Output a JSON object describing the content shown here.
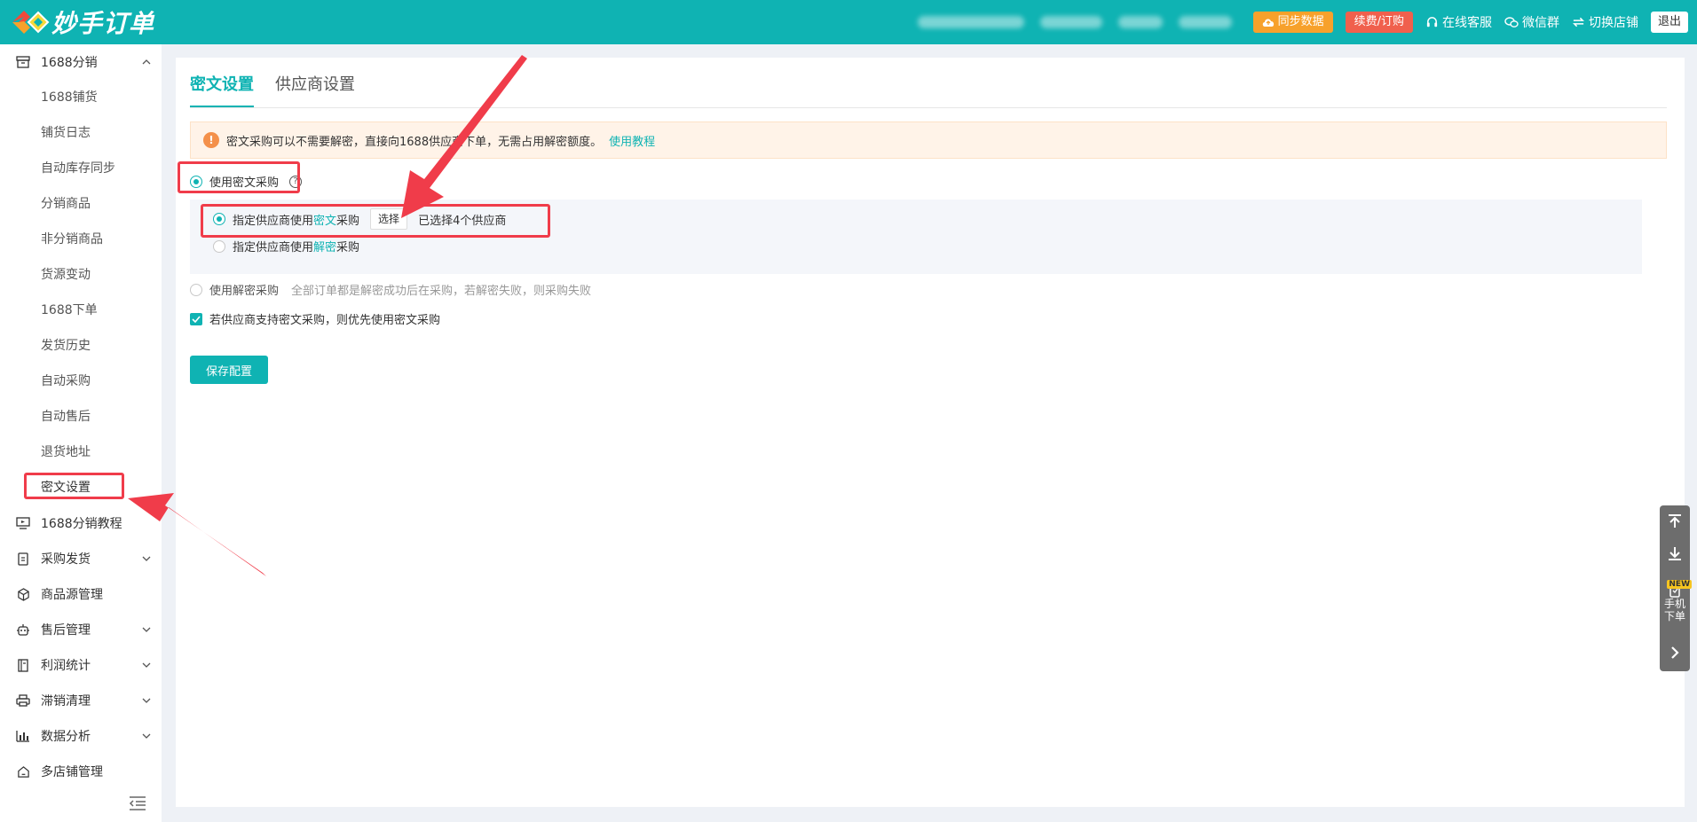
{
  "header": {
    "app_name": "妙手订单",
    "sync_label": "同步数据",
    "renew_label": "续费/订购",
    "support_label": "在线客服",
    "wechat_label": "微信群",
    "switch_shop_label": "切换店铺",
    "logout_label": "退出",
    "colors": {
      "brand": "#0fb3b3",
      "sync": "#f7a12b",
      "renew": "#f0604d"
    }
  },
  "sidebar": {
    "group_1688": "1688分销",
    "sub_items": [
      "1688铺货",
      "铺货日志",
      "自动库存同步",
      "分销商品",
      "非分销商品",
      "货源变动",
      "1688下单",
      "发货历史",
      "自动采购",
      "自动售后",
      "退货地址",
      "密文设置"
    ],
    "groups": [
      {
        "label": "1688分销教程",
        "icon": "monitor-icon"
      },
      {
        "label": "采购发货",
        "icon": "document-icon"
      },
      {
        "label": "商品源管理",
        "icon": "cube-icon"
      },
      {
        "label": "售后管理",
        "icon": "robot-icon"
      },
      {
        "label": "利润统计",
        "icon": "ledger-icon"
      },
      {
        "label": "滞销清理",
        "icon": "printer-icon"
      },
      {
        "label": "数据分析",
        "icon": "bar-chart-icon"
      },
      {
        "label": "多店铺管理",
        "icon": "home-icon"
      }
    ]
  },
  "main": {
    "tabs": [
      "密文设置",
      "供应商设置"
    ],
    "alert_text": "密文采购可以不需要解密，直接向1688供应商下单，无需占用解密额度。",
    "alert_link": "使用教程",
    "option_cipher": "使用密文采购",
    "sub_option_1_prefix": "指定供应商使用",
    "sub_option_1_highlight": "密文",
    "sub_option_1_suffix": "采购",
    "select_button": "选择",
    "selected_text": "已选择4个供应商",
    "sub_option_2_prefix": "指定供应商使用",
    "sub_option_2_highlight": "解密",
    "sub_option_2_suffix": "采购",
    "option_decrypt": "使用解密采购",
    "option_decrypt_note": "全部订单都是解密成功后在采购，若解密失败，则采购失败",
    "checkbox_label": "若供应商支持密文采购，则优先使用密文采购",
    "save_button": "保存配置"
  },
  "float_bar": {
    "mobile_label_1": "手机",
    "mobile_label_2": "下单",
    "new_badge": "NEW"
  }
}
